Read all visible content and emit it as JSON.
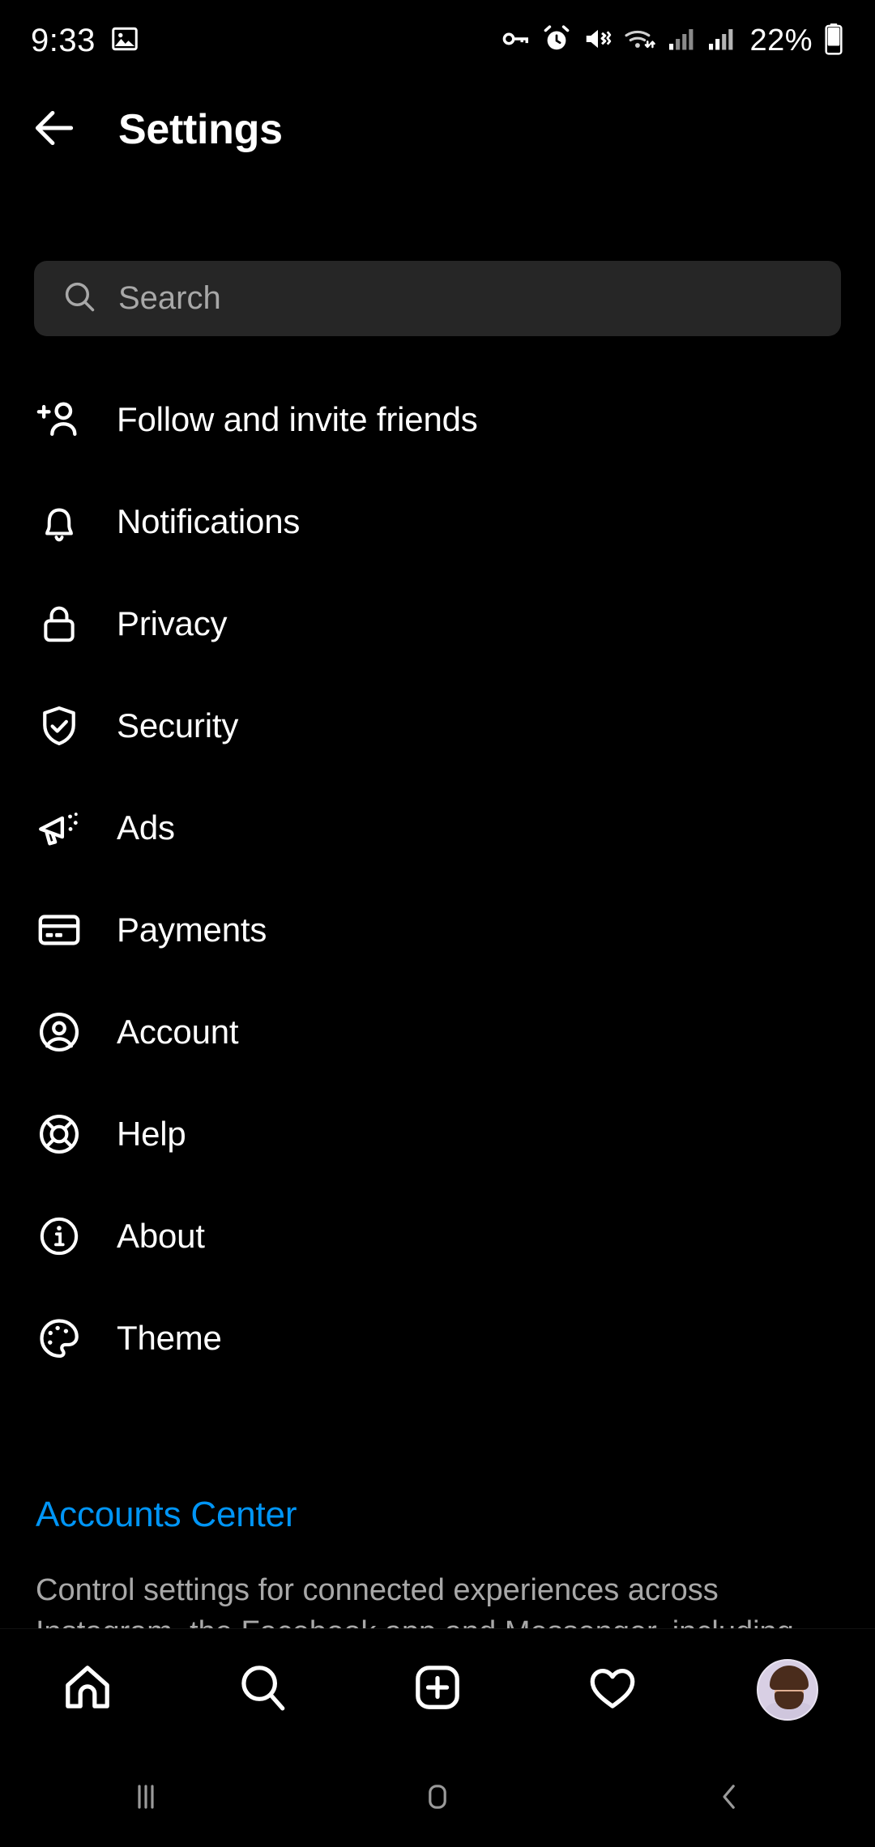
{
  "status_bar": {
    "time": "9:33",
    "battery_percent": "22%",
    "icons": [
      "image-icon",
      "vpn-key-icon",
      "alarm-icon",
      "vibrate-icon",
      "wifi-icon",
      "signal-bars-icon-1",
      "signal-bars-icon-2",
      "battery-icon"
    ]
  },
  "header": {
    "title": "Settings",
    "back_icon": "back-arrow-icon"
  },
  "search": {
    "placeholder": "Search",
    "value": "",
    "icon": "search-icon"
  },
  "settings_list": [
    {
      "label": "Follow and invite friends",
      "icon": "person-add-icon"
    },
    {
      "label": "Notifications",
      "icon": "bell-icon"
    },
    {
      "label": "Privacy",
      "icon": "lock-icon"
    },
    {
      "label": "Security",
      "icon": "shield-check-icon"
    },
    {
      "label": "Ads",
      "icon": "megaphone-icon"
    },
    {
      "label": "Payments",
      "icon": "credit-card-icon"
    },
    {
      "label": "Account",
      "icon": "account-circle-icon"
    },
    {
      "label": "Help",
      "icon": "life-ring-icon"
    },
    {
      "label": "About",
      "icon": "info-circle-icon"
    },
    {
      "label": "Theme",
      "icon": "palette-icon"
    }
  ],
  "accounts_center": {
    "title": "Accounts Center",
    "description": "Control settings for connected experiences across Instagram, the Facebook app and Messenger, including"
  },
  "tab_bar": [
    {
      "name": "home",
      "icon": "home-icon"
    },
    {
      "name": "search",
      "icon": "search-icon"
    },
    {
      "name": "create",
      "icon": "plus-square-icon"
    },
    {
      "name": "activity",
      "icon": "heart-icon"
    },
    {
      "name": "profile",
      "icon": "avatar-icon"
    }
  ],
  "android_nav": [
    {
      "name": "recents",
      "icon": "recents-icon"
    },
    {
      "name": "home",
      "icon": "home-square-icon"
    },
    {
      "name": "back",
      "icon": "back-chevron-icon"
    }
  ],
  "colors": {
    "background": "#000000",
    "accent_link": "#0095f6",
    "search_field": "#262626",
    "secondary_text": "#a8a8a8"
  }
}
